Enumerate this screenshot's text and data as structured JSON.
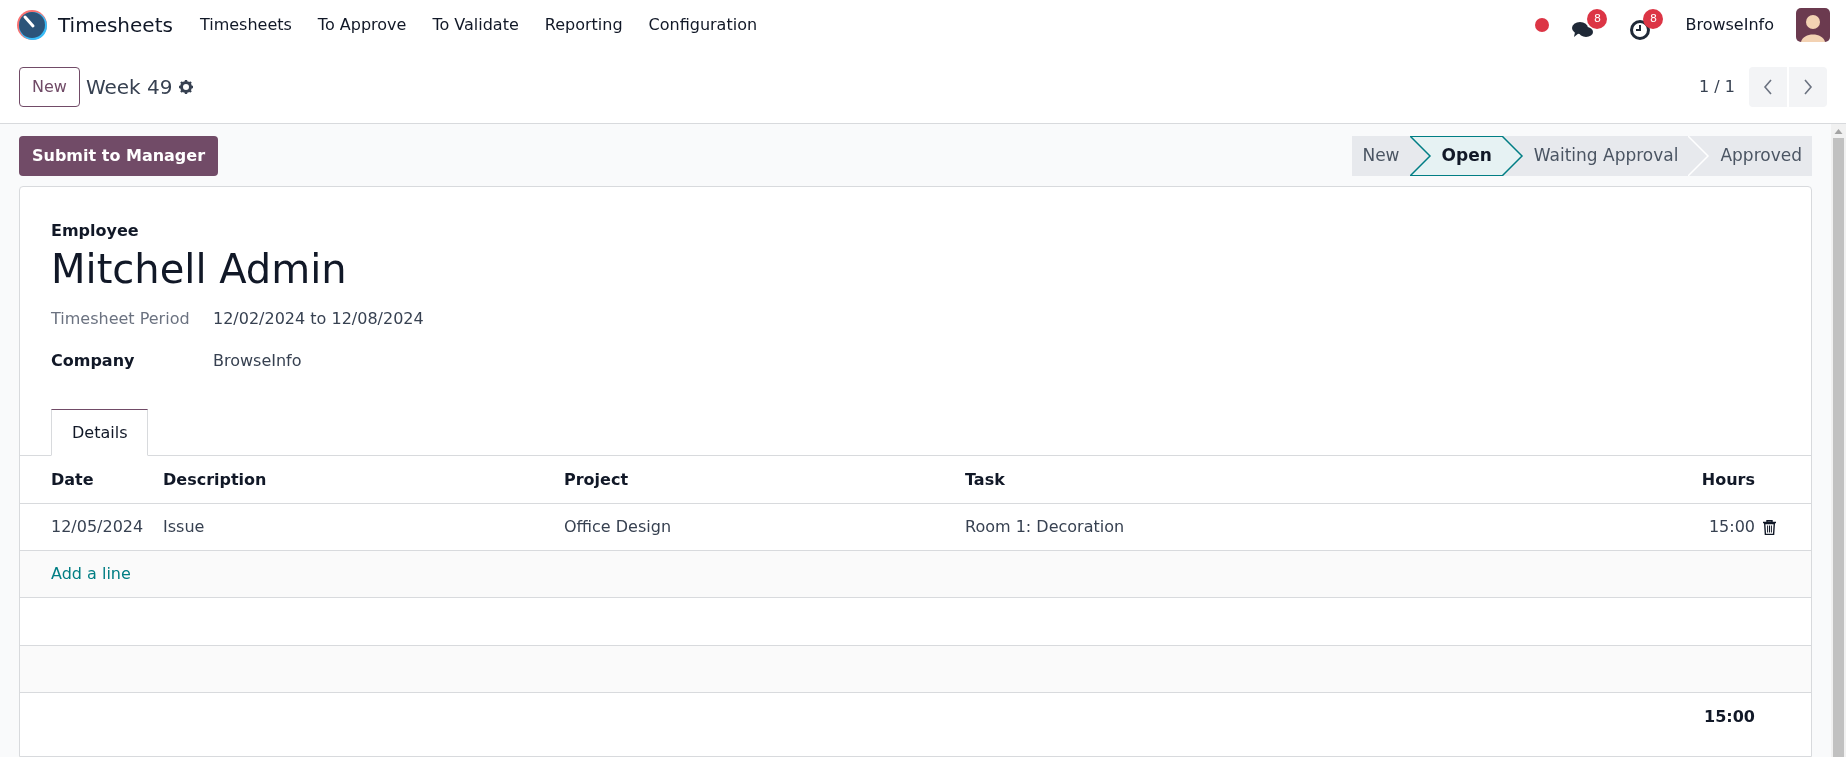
{
  "navbar": {
    "app_name": "Timesheets",
    "menu": [
      "Timesheets",
      "To Approve",
      "To Validate",
      "Reporting",
      "Configuration"
    ],
    "messages_badge": "8",
    "activities_badge": "8",
    "user": "BrowseInfo"
  },
  "control_panel": {
    "new_button": "New",
    "record_title": "Week 49",
    "pager": "1 / 1"
  },
  "actions": {
    "submit_button": "Submit to Manager"
  },
  "statusbar": [
    {
      "label": "New",
      "selected": false
    },
    {
      "label": "Open",
      "selected": true
    },
    {
      "label": "Waiting Approval",
      "selected": false
    },
    {
      "label": "Approved",
      "selected": false
    }
  ],
  "form": {
    "employee_label": "Employee",
    "employee_name": "Mitchell Admin",
    "fields": [
      {
        "label": "Timesheet Period",
        "value": "12/02/2024 to 12/08/2024",
        "bold": false
      },
      {
        "label": "Company",
        "value": "BrowseInfo",
        "bold": true
      }
    ]
  },
  "tabs": [
    {
      "label": "Details",
      "selected": true
    }
  ],
  "table": {
    "columns": [
      "Date",
      "Description",
      "Project",
      "Task",
      "Hours"
    ],
    "rows": [
      {
        "cells": [
          "12/05/2024",
          "Issue",
          "Office Design",
          "Room 1: Decoration",
          "15:00"
        ]
      }
    ],
    "add_line": "Add a line",
    "total": "15:00"
  }
}
